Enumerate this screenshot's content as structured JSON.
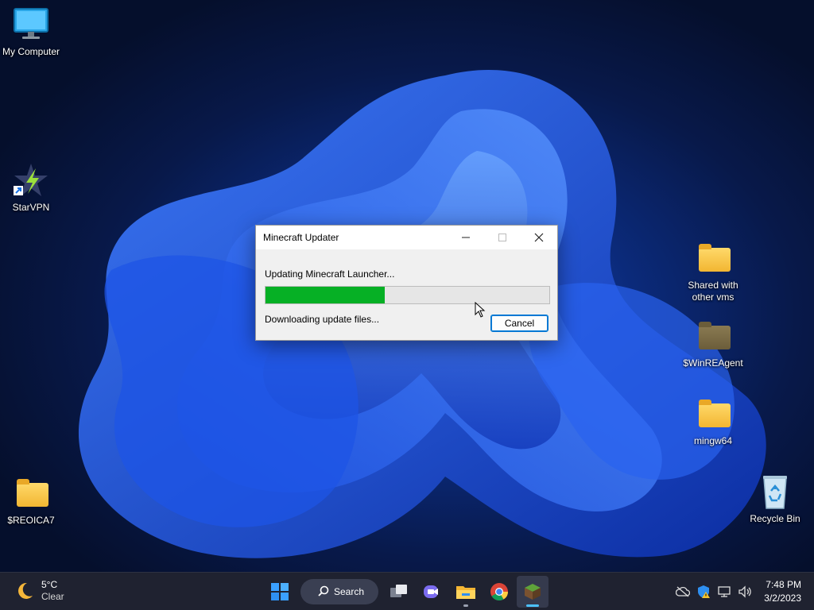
{
  "desktop": {
    "icons": [
      {
        "label": "My Computer",
        "icon": "monitor-icon"
      },
      {
        "label": "StarVPN",
        "icon": "starvpn-icon"
      },
      {
        "label": "$REOICA7",
        "icon": "folder-icon"
      },
      {
        "label": "Shared with other vms",
        "icon": "folder-icon"
      },
      {
        "label": "$WinREAgent",
        "icon": "folder-icon"
      },
      {
        "label": "mingw64",
        "icon": "folder-icon"
      },
      {
        "label": "Recycle Bin",
        "icon": "recycle-bin-icon"
      }
    ]
  },
  "dialog": {
    "title": "Minecraft Updater",
    "status_primary": "Updating Minecraft Launcher...",
    "progress_percent": 42,
    "status_secondary": "Downloading update files...",
    "cancel_label": "Cancel"
  },
  "taskbar": {
    "weather": {
      "temperature": "5°C",
      "condition": "Clear",
      "icon": "moon-icon"
    },
    "search_label": "Search",
    "apps": [
      "start-icon",
      "task-view-icon",
      "teams-chat-icon",
      "file-explorer-icon",
      "chrome-icon",
      "minecraft-icon"
    ],
    "clock": {
      "time": "7:48 PM",
      "date": "3/2/2023"
    }
  },
  "colors": {
    "progress_fill": "#06b025",
    "accent": "#0078d4",
    "taskbar_bg": "#1f2230"
  }
}
